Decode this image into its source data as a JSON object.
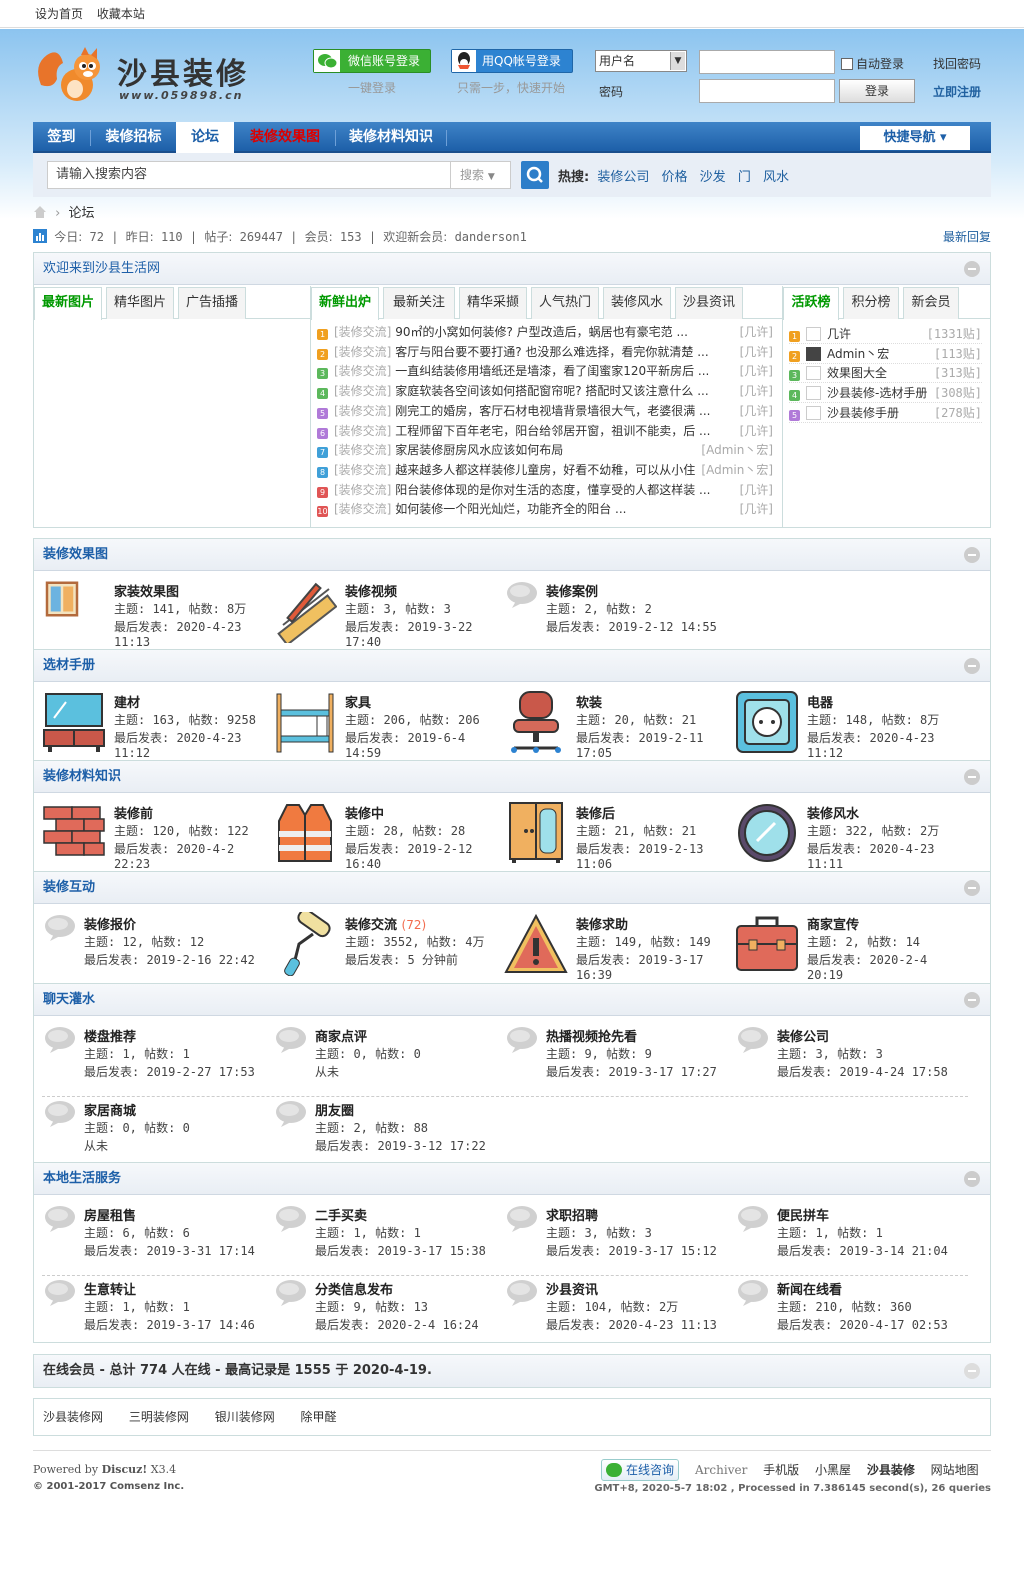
{
  "topbar": {
    "home": "设为首页",
    "fav": "收藏本站"
  },
  "logo": {
    "title": "沙县装修",
    "url": "www.059898.cn"
  },
  "login": {
    "wechat": "微信账号登录",
    "wechat_sub": "一键登录",
    "qq": "用QQ帐号登录",
    "qq_sub": "只需一步，快速开始",
    "user_select": "用户名",
    "pw_label": "密码",
    "auto": "自动登录",
    "submit": "登录",
    "find_pw": "找回密码",
    "register": "立即注册"
  },
  "nav": {
    "items": [
      "签到",
      "装修招标",
      "论坛",
      "装修效果图",
      "装修材料知识"
    ],
    "quick": "快捷导航"
  },
  "search": {
    "placeholder": "请输入搜索内容",
    "type": "搜索",
    "hot_label": "热搜:",
    "hot": [
      "装修公司",
      "价格",
      "沙发",
      "门",
      "风水"
    ]
  },
  "crumb": {
    "label": "论坛"
  },
  "stats": {
    "today_lbl": "今日:",
    "today": "72",
    "yest_lbl": "昨日:",
    "yest": "110",
    "posts_lbl": "帖子:",
    "posts": "269447",
    "members_lbl": "会员:",
    "members": "153",
    "welcome_lbl": "欢迎新会员:",
    "new_member": "danderson1",
    "latest": "最新回复"
  },
  "welcome": {
    "title": "欢迎来到沙县生活网",
    "tabs_left": [
      "最新图片",
      "精华图片",
      "广告插播"
    ],
    "tabs_mid": [
      "新鲜出炉",
      "最新关注",
      "精华采撷",
      "人气热门",
      "装修风水",
      "沙县资讯"
    ],
    "tabs_right": [
      "活跃榜",
      "积分榜",
      "新会员"
    ],
    "threads": [
      {
        "n": "1",
        "c": "#f0a020",
        "cat": "[装修交流]",
        "t": "90㎡的小窝如何装修? 户型改造后，蜗居也有豪宅范 ...",
        "a": "[几许]"
      },
      {
        "n": "2",
        "c": "#f0a020",
        "cat": "[装修交流]",
        "t": "客厅与阳台要不要打通? 也没那么难选择，看完你就清楚 ...",
        "a": "[几许]"
      },
      {
        "n": "3",
        "c": "#5cb85c",
        "cat": "[装修交流]",
        "t": "一直纠结装修用墙纸还是墙漆，看了闺蜜家120平新房后 ...",
        "a": "[几许]"
      },
      {
        "n": "4",
        "c": "#5cb85c",
        "cat": "[装修交流]",
        "t": "家庭软装各空间该如何搭配窗帘呢? 搭配时又该注意什么 ...",
        "a": "[几许]"
      },
      {
        "n": "5",
        "c": "#b07ad8",
        "cat": "[装修交流]",
        "t": "刚完工的婚房，客厅石材电视墙背景墙很大气，老婆很满 ...",
        "a": "[几许]"
      },
      {
        "n": "6",
        "c": "#b07ad8",
        "cat": "[装修交流]",
        "t": "工程师留下百年老宅，阳台给邻居开窗，祖训不能卖，后 ...",
        "a": "[几许]"
      },
      {
        "n": "7",
        "c": "#3fa0d8",
        "cat": "[装修交流]",
        "t": "家居装修厨房风水应该如何布局",
        "a": "[Admin丶宏]"
      },
      {
        "n": "8",
        "c": "#3fa0d8",
        "cat": "[装修交流]",
        "t": "越来越多人都这样装修儿童房，好看不幼稚，可以从小住",
        "a": "[Admin丶宏]"
      },
      {
        "n": "9",
        "c": "#e05555",
        "cat": "[装修交流]",
        "t": "阳台装修体现的是你对生活的态度，懂享受的人都这样装 ...",
        "a": "[几许]"
      },
      {
        "n": "10",
        "c": "#e05555",
        "cat": "[装修交流]",
        "t": "如何装修一个阳光灿烂，功能齐全的阳台 ...",
        "a": "[几许]"
      }
    ],
    "ranks": [
      {
        "n": "1",
        "c": "#f0a020",
        "name": "几许",
        "v": "[1331贴]"
      },
      {
        "n": "2",
        "c": "#f0a020",
        "name": "Admin丶宏",
        "v": "[113贴]"
      },
      {
        "n": "3",
        "c": "#5cb85c",
        "name": "效果图大全",
        "v": "[313贴]"
      },
      {
        "n": "4",
        "c": "#5cb85c",
        "name": "沙县装修-选材手册",
        "v": "[308贴]"
      },
      {
        "n": "5",
        "c": "#b07ad8",
        "name": "沙县装修手册",
        "v": "[278贴]"
      }
    ]
  },
  "sections": [
    {
      "title": "装修效果图",
      "forums": [
        {
          "name": "家装效果图",
          "l1": "主题: 141, 帖数: 8万",
          "l2": "最后发表: 2020-4-23 11:13",
          "icon": "frame-icon"
        },
        {
          "name": "装修视频",
          "l1": "主题: 3, 帖数: 3",
          "l2": "最后发表: 2019-3-22 17:40",
          "icon": "ruler-icon"
        },
        {
          "name": "装修案例",
          "l1": "主题: 2, 帖数: 2",
          "l2": "最后发表: 2019-2-12 14:55",
          "icon": "bubble-icon"
        }
      ]
    },
    {
      "title": "选材手册",
      "forums": [
        {
          "name": "建材",
          "l1": "主题: 163, 帖数: 9258",
          "l2": "最后发表: 2020-4-23 11:12",
          "icon": "tv-cabinet-icon"
        },
        {
          "name": "家具",
          "l1": "主题: 206, 帖数: 206",
          "l2": "最后发表: 2019-6-4 14:59",
          "icon": "bunk-bed-icon"
        },
        {
          "name": "软装",
          "l1": "主题: 20, 帖数: 21",
          "l2": "最后发表: 2019-2-11 17:05",
          "icon": "chair-icon"
        },
        {
          "name": "电器",
          "l1": "主题: 148, 帖数: 8万",
          "l2": "最后发表: 2020-4-23 11:12",
          "icon": "socket-icon"
        }
      ]
    },
    {
      "title": "装修材料知识",
      "forums": [
        {
          "name": "装修前",
          "l1": "主题: 120, 帖数: 122",
          "l2": "最后发表: 2020-4-2 22:23",
          "icon": "brick-icon"
        },
        {
          "name": "装修中",
          "l1": "主题: 28, 帖数: 28",
          "l2": "最后发表: 2019-2-12 16:40",
          "icon": "vest-icon"
        },
        {
          "name": "装修后",
          "l1": "主题: 21, 帖数: 21",
          "l2": "最后发表: 2019-2-13 11:06",
          "icon": "wardrobe-icon"
        },
        {
          "name": "装修风水",
          "l1": "主题: 322, 帖数: 2万",
          "l2": "最后发表: 2020-4-23 11:11",
          "icon": "mirror-icon"
        }
      ]
    },
    {
      "title": "装修互动",
      "forums": [
        {
          "name": "装修报价",
          "l1": "主题: 12, 帖数: 12",
          "l2": "最后发表: 2019-2-16 22:42",
          "icon": "bubble-icon"
        },
        {
          "name": "装修交流",
          "extra": "(72)",
          "l1": "主题: 3552, 帖数: 4万",
          "l2": "最后发表: 5 分钟前",
          "icon": "roller-icon"
        },
        {
          "name": "装修求助",
          "l1": "主题: 149, 帖数: 149",
          "l2": "最后发表: 2019-3-17 16:39",
          "icon": "warning-icon"
        },
        {
          "name": "商家宣传",
          "l1": "主题: 2, 帖数: 14",
          "l2": "最后发表: 2020-2-4 20:19",
          "icon": "toolbox-icon"
        }
      ]
    },
    {
      "title": "聊天灌水",
      "forums": [
        {
          "name": "楼盘推荐",
          "l1": "主题: 1, 帖数: 1",
          "l2": "最后发表: 2019-2-27 17:53",
          "icon": "bubble-icon"
        },
        {
          "name": "商家点评",
          "l1": "主题: 0, 帖数: 0",
          "l2": "从未",
          "icon": "bubble-icon"
        },
        {
          "name": "热播视频抢先看",
          "l1": "主题: 9, 帖数: 9",
          "l2": "最后发表: 2019-3-17 17:27",
          "icon": "bubble-icon"
        },
        {
          "name": "装修公司",
          "l1": "主题: 3, 帖数: 3",
          "l2": "最后发表: 2019-4-24 17:58",
          "icon": "bubble-icon"
        },
        {
          "name": "家居商城",
          "l1": "主题: 0, 帖数: 0",
          "l2": "从未",
          "icon": "bubble-icon"
        },
        {
          "name": "朋友圈",
          "l1": "主题: 2, 帖数: 88",
          "l2": "最后发表: 2019-3-12 17:22",
          "icon": "bubble-icon"
        }
      ]
    },
    {
      "title": "本地生活服务",
      "forums": [
        {
          "name": "房屋租售",
          "l1": "主题: 6, 帖数: 6",
          "l2": "最后发表: 2019-3-31 17:14",
          "icon": "bubble-icon"
        },
        {
          "name": "二手买卖",
          "l1": "主题: 1, 帖数: 1",
          "l2": "最后发表: 2019-3-17 15:38",
          "icon": "bubble-icon"
        },
        {
          "name": "求职招聘",
          "l1": "主题: 3, 帖数: 3",
          "l2": "最后发表: 2019-3-17 15:12",
          "icon": "bubble-icon"
        },
        {
          "name": "便民拼车",
          "l1": "主题: 1, 帖数: 1",
          "l2": "最后发表: 2019-3-14 21:04",
          "icon": "bubble-icon"
        },
        {
          "name": "生意转让",
          "l1": "主题: 1, 帖数: 1",
          "l2": "最后发表: 2019-3-17 14:46",
          "icon": "bubble-icon"
        },
        {
          "name": "分类信息发布",
          "l1": "主题: 9, 帖数: 13",
          "l2": "最后发表: 2020-2-4 16:24",
          "icon": "bubble-icon"
        },
        {
          "name": "沙县资讯",
          "l1": "主题: 104, 帖数: 2万",
          "l2": "最后发表: 2020-4-23 11:13",
          "icon": "bubble-icon"
        },
        {
          "name": "新闻在线看",
          "l1": "主题: 210, 帖数: 360",
          "l2": "最后发表: 2020-4-17 02:53",
          "icon": "bubble-icon"
        }
      ]
    }
  ],
  "online": "在线会员 - 总计 774 人在线 - 最高记录是 1555 于 2020-4-19.",
  "links": [
    "沙县装修网",
    "三明装修网",
    "银川装修网",
    "除甲醛"
  ],
  "footer": {
    "powered": "Powered by",
    "brand": "Discuz!",
    "ver": "X3.4",
    "copy": "© 2001-2017 Comsenz Inc.",
    "consult": "在线咨询",
    "links": [
      "Archiver",
      "手机版",
      "小黑屋",
      "沙县装修",
      "网站地图"
    ],
    "gmt": "GMT+8, 2020-5-7 18:02 , Processed in 7.386145 second(s), 26 queries"
  },
  "colors": {
    "nav": "#1d5fa8",
    "link": "#2161a0",
    "wechat": "#3bb034",
    "qq": "#2d83d1"
  }
}
